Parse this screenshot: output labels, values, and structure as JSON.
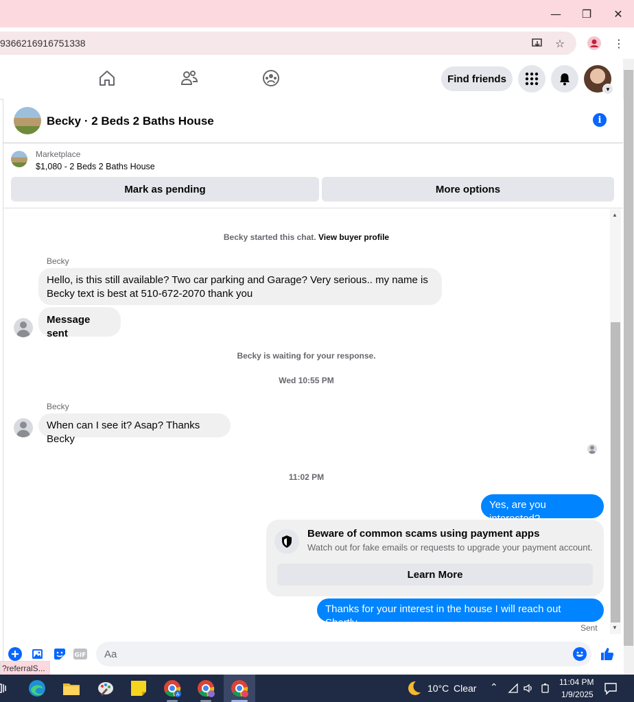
{
  "browser": {
    "url_fragment": "9366216916751338",
    "status_url": "?referralS..."
  },
  "nav": {
    "find_friends": "Find friends"
  },
  "chat": {
    "title": "Becky · 2 Beds 2 Baths House",
    "marketplace_label": "Marketplace",
    "listing": "$1,080 - 2 Beds 2 Baths House",
    "mark_pending": "Mark as pending",
    "more_options": "More options",
    "started_text": "Becky started this chat.",
    "view_profile": "View buyer profile",
    "waiting_text": "Becky is waiting for your response.",
    "timestamp1": "Wed 10:55 PM",
    "timestamp2": "11:02 PM",
    "sent_label": "Sent",
    "messages": [
      {
        "sender": "Becky",
        "text1": "Hello, is this still available? Two car parking and Garage? Very serious.. my name is",
        "text2": "Becky text is best at 510-672-2070 thank you"
      },
      {
        "text": "Message sent"
      },
      {
        "sender": "Becky",
        "text": "When can I see it? Asap? Thanks Becky"
      },
      {
        "text": "Yes, are you interested?"
      },
      {
        "text": "Thanks for your interest in the house I will reach out Shortly"
      }
    ],
    "scam_card": {
      "title": "Beware of common scams using payment apps",
      "desc": "Watch out for fake emails or requests to upgrade your payment account.",
      "button": "Learn More"
    },
    "composer_placeholder": "Aa"
  },
  "taskbar": {
    "weather_temp": "10°C",
    "weather_desc": "Clear",
    "time": "11:04 PM",
    "date": "1/9/2025"
  },
  "colors": {
    "accent": "#0084ff",
    "fb_blue": "#0866ff"
  }
}
